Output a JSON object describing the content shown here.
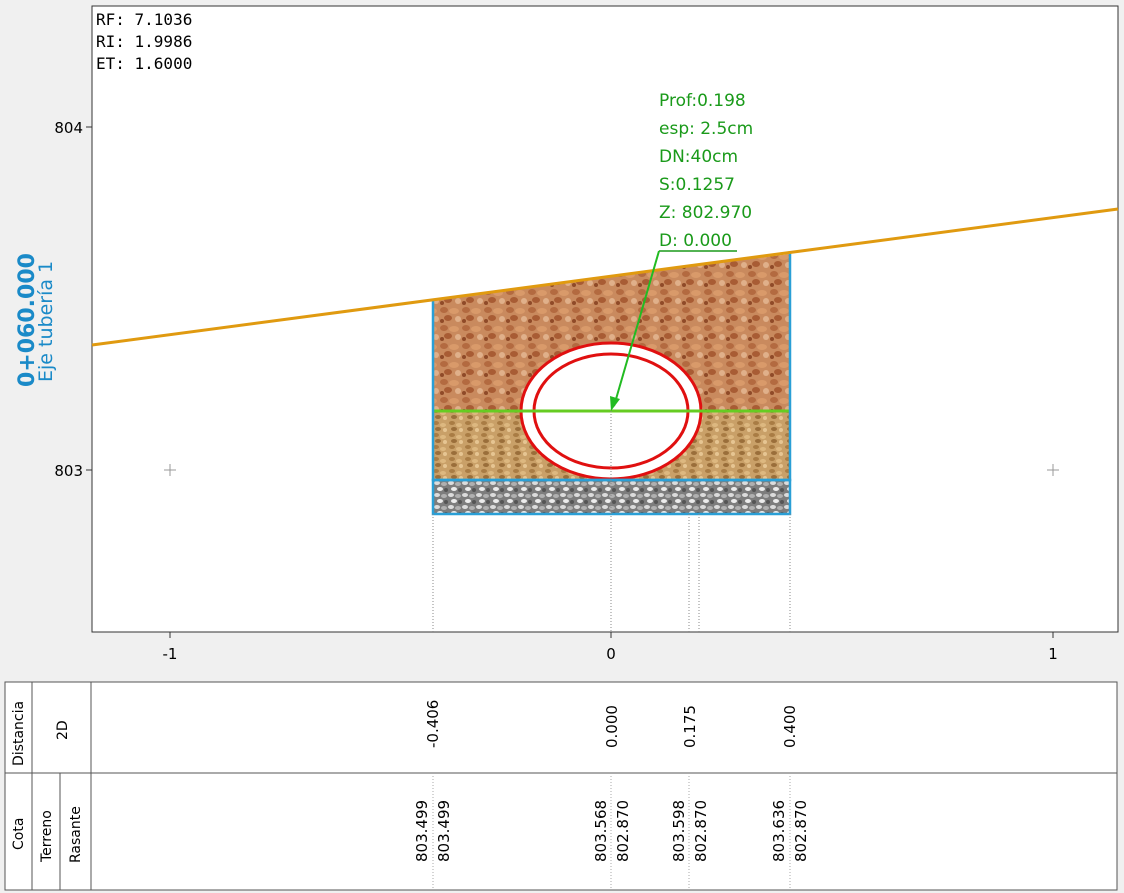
{
  "info": {
    "rf": "RF: 7.1036",
    "ri": "RI: 1.9986",
    "et": "ET: 1.6000"
  },
  "side_title": {
    "station": "0+060.000",
    "axis": "Eje tubería 1"
  },
  "pipe_label": {
    "prof": "Prof:0.198",
    "esp": "esp: 2.5cm",
    "dn": "DN:40cm",
    "s": "S:0.1257",
    "z": "Z: 802.970",
    "d": "D:  0.000"
  },
  "y_ticks": [
    "804",
    "803"
  ],
  "x_ticks": [
    "-1",
    "0",
    "1"
  ],
  "table": {
    "distancia_label": "Distancia",
    "d2_label": "2D",
    "cota_label": "Cota",
    "terreno_label": "Terreno",
    "rasante_label": "Rasante",
    "distances": [
      "-0.406",
      "0.000",
      "0.175",
      "0.400"
    ],
    "terreno": [
      "803.499",
      "803.568",
      "803.598",
      "803.636"
    ],
    "rasante": [
      "803.499",
      "802.870",
      "802.870",
      "802.870"
    ]
  },
  "colors": {
    "terrain_line": "#e09a10",
    "trench_outline": "#2a9fd6",
    "pipe": "#e01010",
    "water_line": "#66cc22",
    "label_green": "#1a9a1a",
    "station_blue": "#1a8ac8"
  }
}
